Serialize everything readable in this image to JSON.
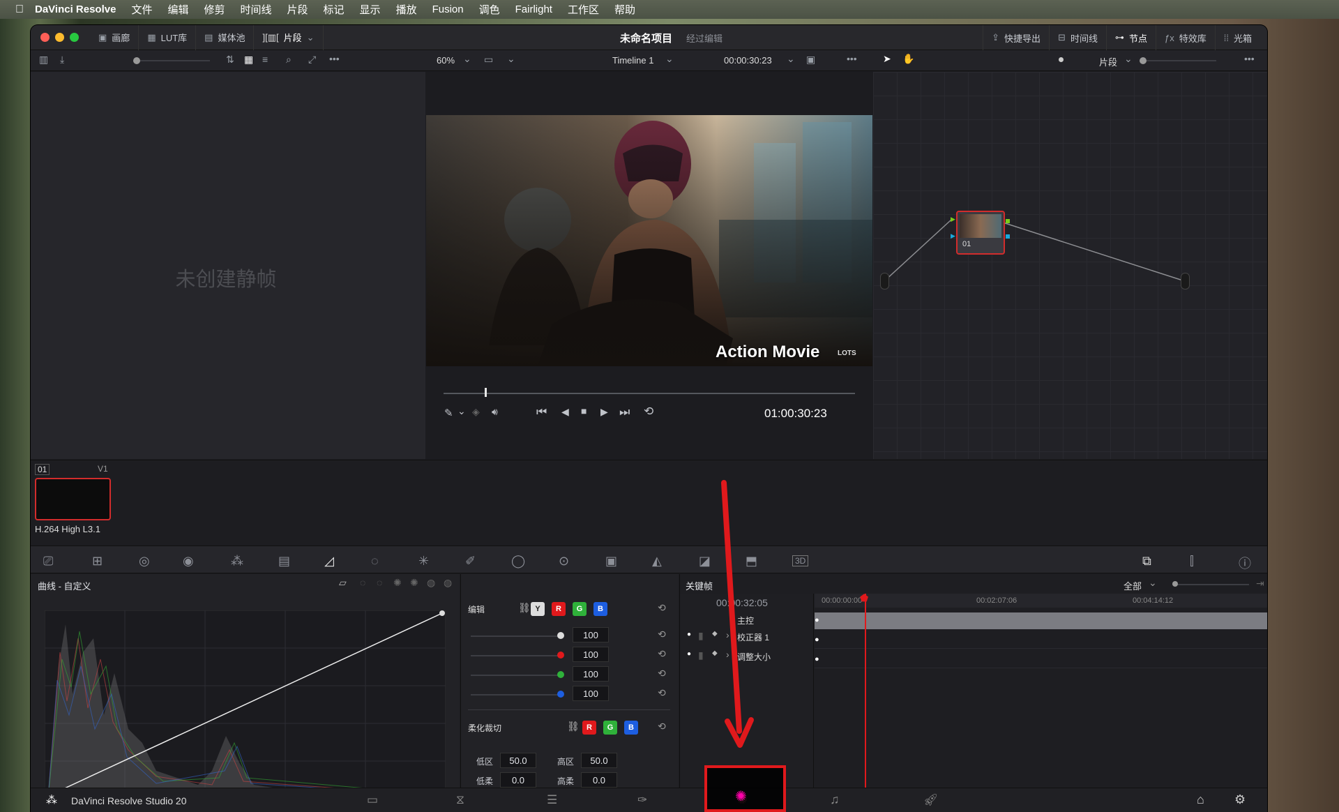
{
  "menubar": {
    "app": "DaVinci Resolve",
    "items": [
      "文件",
      "编辑",
      "修剪",
      "时间线",
      "片段",
      "标记",
      "显示",
      "播放",
      "Fusion",
      "调色",
      "Fairlight",
      "工作区",
      "帮助"
    ]
  },
  "titlebar": {
    "tabs": [
      {
        "icon": "gallery-icon",
        "label": "画廊"
      },
      {
        "icon": "lut-icon",
        "label": "LUT库"
      },
      {
        "icon": "media-pool-icon",
        "label": "媒体池"
      },
      {
        "icon": "clips-icon",
        "label": "片段"
      }
    ],
    "project": "未命名项目",
    "status": "经过编辑",
    "right": [
      {
        "icon": "quick-export-icon",
        "label": "快捷导出"
      },
      {
        "icon": "timeline-icon",
        "label": "时间线"
      },
      {
        "icon": "nodes-icon",
        "label": "节点"
      },
      {
        "icon": "effects-icon",
        "label": "特效库"
      },
      {
        "icon": "lightbox-icon",
        "label": "光箱"
      }
    ]
  },
  "toolbar": {
    "zoom": "60%",
    "timeline": "Timeline 1",
    "timecode": "00:00:30:23",
    "mode": "片段"
  },
  "gallery": {
    "empty": "未创建静帧"
  },
  "viewer": {
    "overlay_title": "Action Movie",
    "overlay_brand": "LOTS",
    "timecode": "01:00:30:23",
    "progress": 0.1
  },
  "nodes": {
    "node_label": "01"
  },
  "clips": {
    "index": "01",
    "track": "V1",
    "codec": "H.264 High L3.1"
  },
  "curves": {
    "title": "曲线 - 自定义"
  },
  "edit": {
    "label": "编辑",
    "channels": [
      "Y",
      "R",
      "G",
      "B"
    ],
    "values": [
      "100",
      "100",
      "100",
      "100"
    ],
    "soft_clip_label": "柔化裁切",
    "low_label": "低区",
    "low_value": "50.0",
    "high_label": "高区",
    "high_value": "50.0",
    "low_soft_label": "低柔",
    "low_soft_value": "0.0",
    "high_soft_label": "高柔",
    "high_soft_value": "0.0"
  },
  "keyframes": {
    "title": "关键帧",
    "filter": "全部",
    "timecode": "00:00:32:05",
    "ruler": [
      "00:00:00:00",
      "00:02:07:06",
      "00:04:14:12"
    ],
    "rows": [
      "主控",
      "校正器 1",
      "调整大小"
    ]
  },
  "bottombar": {
    "app": "DaVinci Resolve Studio 20"
  },
  "colors": {
    "accent": "#e0191c",
    "red": "#e0191c",
    "green": "#2fb13a",
    "blue": "#1d5ee0"
  }
}
